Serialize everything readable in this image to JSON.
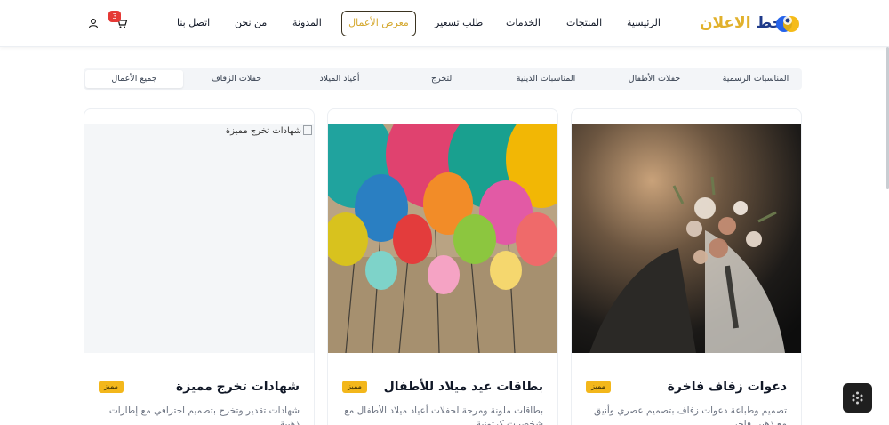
{
  "header": {
    "logo": {
      "part1": "خط ",
      "part2": "الاعلان"
    },
    "nav": [
      {
        "label": "الرئيسية"
      },
      {
        "label": "المنتجات"
      },
      {
        "label": "الخدمات"
      },
      {
        "label": "طلب تسعير"
      },
      {
        "label": "معرض الأعمال"
      },
      {
        "label": "المدونة"
      },
      {
        "label": "من نحن"
      },
      {
        "label": "اتصل بنا"
      }
    ],
    "cart_count": "3",
    "icons": {
      "cart": "cart-icon",
      "user": "user-icon"
    }
  },
  "filters": {
    "tabs": [
      {
        "label": "المناسبات الرسمية"
      },
      {
        "label": "حفلات الأطفال"
      },
      {
        "label": "المناسبات الدينية"
      },
      {
        "label": "التخرج"
      },
      {
        "label": "أعياد الميلاد"
      },
      {
        "label": "حفلات الزفاف"
      },
      {
        "label": "جميع الأعمال"
      }
    ],
    "active": "جميع الأعمال"
  },
  "cards": [
    {
      "title": "دعوات زفاف فاخرة",
      "badge": "مميز",
      "description": "تصميم وطباعة دعوات زفاف بتصميم عصري وأنيق مع ذهبي فاخر"
    },
    {
      "title": "بطاقات عيد ميلاد للأطفال",
      "badge": "مميز",
      "description": "بطاقات ملونة ومرحة لحفلات أعياد ميلاد الأطفال مع شخصيات كرتونية"
    },
    {
      "title": "شهادات تخرج مميزة",
      "badge": "مميز",
      "image_alt": "شهادات تخرج مميزة",
      "description": "شهادات تقدير وتخرج بتصميم احترافي مع إطارات ذهبية"
    }
  ],
  "colors": {
    "accent": "#d4a72c",
    "brand": "#1e3a8a",
    "badge": "#f3b71b",
    "cart_badge": "#e53935"
  }
}
